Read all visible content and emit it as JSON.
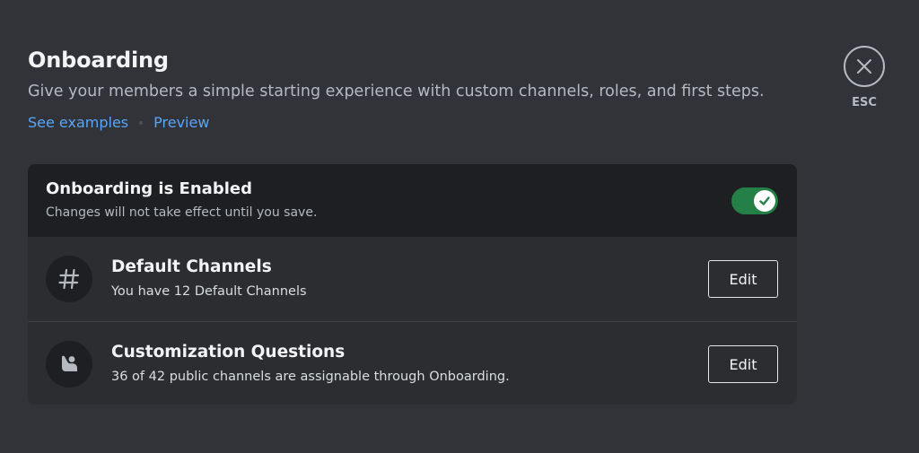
{
  "header": {
    "title": "Onboarding",
    "subtitle": "Give your members a simple starting experience with custom channels, roles, and first steps.",
    "links": [
      "See examples",
      "Preview"
    ]
  },
  "close": {
    "label": "ESC",
    "icon": "close-icon"
  },
  "card": {
    "status": {
      "title": "Onboarding is Enabled",
      "note": "Changes will not take effect until you save.",
      "toggle_on": true
    },
    "rows": [
      {
        "icon": "hash-icon",
        "title": "Default Channels",
        "subtitle": "You have 12 Default Channels",
        "button": "Edit"
      },
      {
        "icon": "person-question-icon",
        "title": "Customization Questions",
        "subtitle": "36 of 42 public channels are assignable through Onboarding.",
        "button": "Edit"
      }
    ]
  },
  "colors": {
    "background": "#323338",
    "card": "#2b2d31",
    "card_header": "#1e1f22",
    "link": "#58a6f5",
    "toggle_on": "#248046"
  }
}
